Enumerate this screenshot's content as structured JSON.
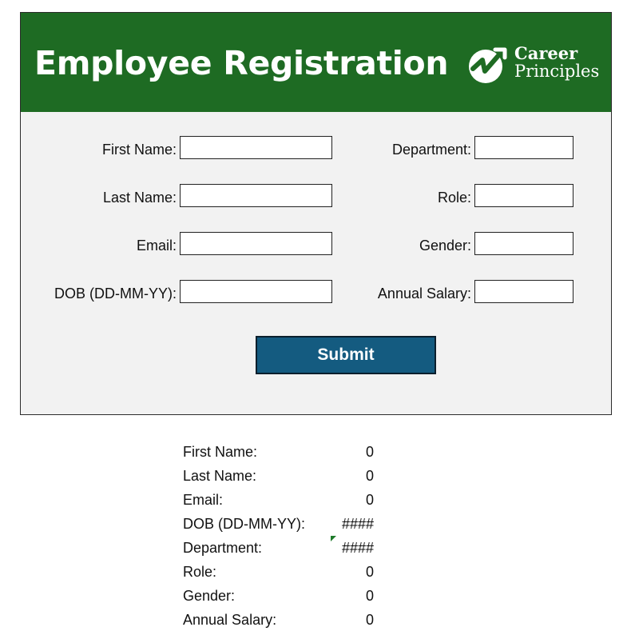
{
  "header": {
    "title": "Employee Registration",
    "logo_line1": "Career",
    "logo_line2": "Principles",
    "background_color": "#1e6b23"
  },
  "form": {
    "fields": [
      {
        "label": "First Name:",
        "value": ""
      },
      {
        "label": "Last Name:",
        "value": ""
      },
      {
        "label": "Email:",
        "value": ""
      },
      {
        "label": "DOB (DD-MM-YY):",
        "value": ""
      },
      {
        "label": "Department:",
        "value": ""
      },
      {
        "label": "Role:",
        "value": ""
      },
      {
        "label": "Gender:",
        "value": ""
      },
      {
        "label": "Annual Salary:",
        "value": ""
      }
    ],
    "submit_label": "Submit",
    "submit_color": "#145b80"
  },
  "summary": {
    "rows": [
      {
        "label": "First Name:",
        "value": "0"
      },
      {
        "label": "Last Name:",
        "value": "0"
      },
      {
        "label": "Email:",
        "value": "0"
      },
      {
        "label": "DOB (DD-MM-YY):",
        "value": "####"
      },
      {
        "label": "Department:",
        "value": "####"
      },
      {
        "label": "Role:",
        "value": "0"
      },
      {
        "label": "Gender:",
        "value": "0"
      },
      {
        "label": "Annual Salary:",
        "value": "0"
      }
    ]
  }
}
